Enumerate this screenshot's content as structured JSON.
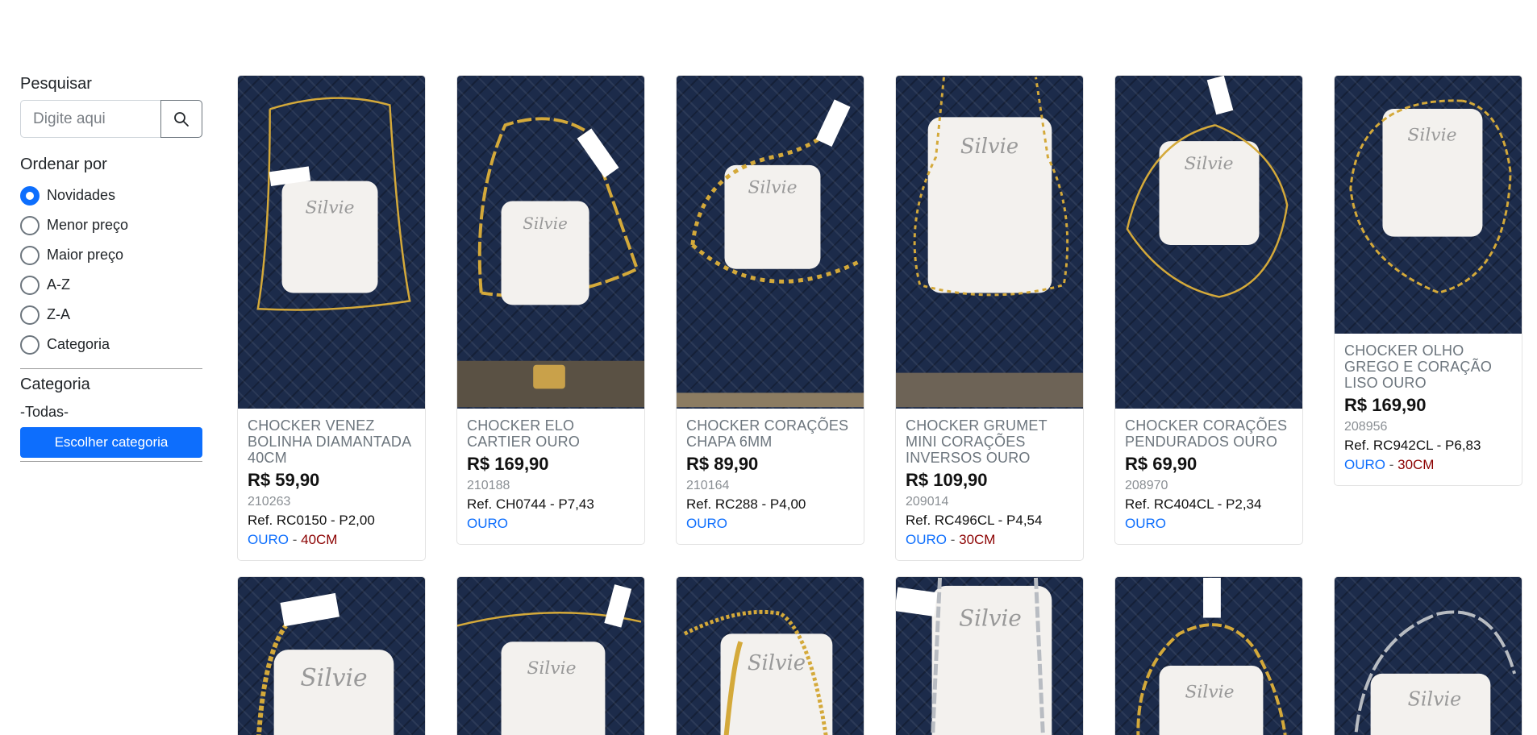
{
  "sidebar": {
    "search_title": "Pesquisar",
    "search_placeholder": "Digite aqui",
    "sort_title": "Ordenar por",
    "sort_options": [
      "Novidades",
      "Menor preço",
      "Maior preço",
      "A-Z",
      "Z-A",
      "Categoria"
    ],
    "sort_selected": "Novidades",
    "category_title": "Categoria",
    "category_value": "-Todas-",
    "category_button": "Escolher categoria"
  },
  "products": [
    {
      "name": "CHOCKER VENEZ BOLINHA DIAMANTADA 40CM",
      "price": "R$ 59,90",
      "code": "210263",
      "ref": "Ref. RC0150 - P2,00",
      "material": "OURO",
      "separator": " - ",
      "size": "40CM"
    },
    {
      "name": "CHOCKER ELO CARTIER OURO",
      "price": "R$ 169,90",
      "code": "210188",
      "ref": "Ref. CH0744 - P7,43",
      "material": "OURO",
      "separator": "",
      "size": ""
    },
    {
      "name": "CHOCKER CORAÇÕES CHAPA 6MM",
      "price": "R$ 89,90",
      "code": "210164",
      "ref": "Ref. RC288 - P4,00",
      "material": "OURO",
      "separator": "",
      "size": ""
    },
    {
      "name": "CHOCKER GRUMET MINI CORAÇÕES INVERSOS OURO",
      "price": "R$ 109,90",
      "code": "209014",
      "ref": "Ref. RC496CL - P4,54",
      "material": "OURO",
      "separator": " - ",
      "size": "30CM"
    },
    {
      "name": "CHOCKER CORAÇÕES PENDURADOS OURO",
      "price": "R$ 69,90",
      "code": "208970",
      "ref": "Ref. RC404CL - P2,34",
      "material": "OURO",
      "separator": "",
      "size": ""
    },
    {
      "name": "CHOCKER OLHO GREGO E CORAÇÃO LISO OURO",
      "price": "R$ 169,90",
      "code": "208956",
      "ref": "Ref. RC942CL - P6,83",
      "material": "OURO",
      "separator": " - ",
      "size": "30CM"
    }
  ],
  "card_brand": "Silvie",
  "colors": {
    "accent": "#0d6efd",
    "size_tag": "#8b0000",
    "display_board": "#1c2b4a",
    "chain_gold": "#d4a93a",
    "chain_silver": "#b8bcc2"
  }
}
